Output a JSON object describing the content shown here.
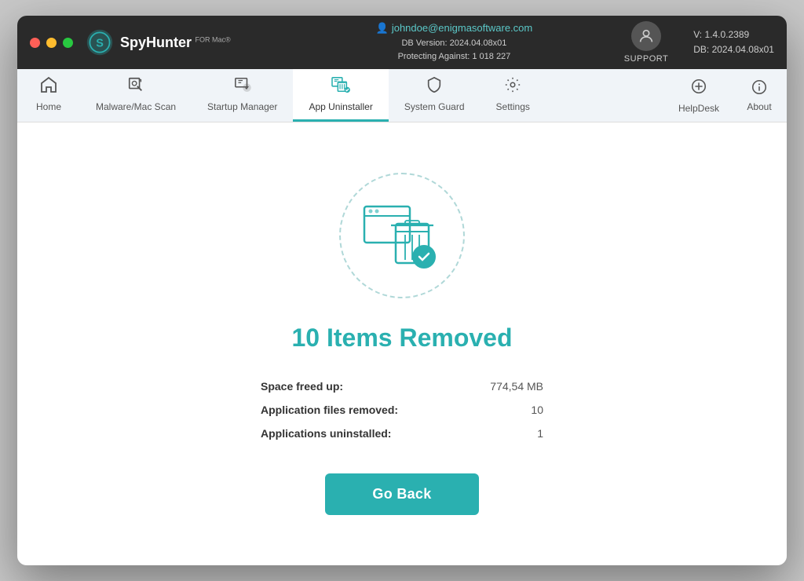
{
  "window": {
    "title": "SpyHunter for Mac"
  },
  "titlebar": {
    "brand": "SpyHunter",
    "brand_suffix": "FOR Mac®",
    "email": "johndoe@enigmasoftware.com",
    "db_version_label": "DB Version: 2024.04.08x01",
    "protecting_label": "Protecting Against: 1 018 227",
    "support_label": "SUPPORT",
    "version_label": "V: 1.4.0.2389",
    "db_label": "DB:  2024.04.08x01"
  },
  "nav": {
    "items": [
      {
        "id": "home",
        "label": "Home",
        "icon": "🏠"
      },
      {
        "id": "malware-scan",
        "label": "Malware/Mac Scan",
        "icon": "🔍"
      },
      {
        "id": "startup-manager",
        "label": "Startup Manager",
        "icon": "⚙"
      },
      {
        "id": "app-uninstaller",
        "label": "App Uninstaller",
        "icon": "📋",
        "active": true
      },
      {
        "id": "system-guard",
        "label": "System Guard",
        "icon": "🛡"
      },
      {
        "id": "settings",
        "label": "Settings",
        "icon": "⚙️"
      }
    ],
    "right_items": [
      {
        "id": "helpdesk",
        "label": "HelpDesk",
        "icon": "➕"
      },
      {
        "id": "about",
        "label": "About",
        "icon": "ℹ"
      }
    ]
  },
  "main": {
    "result_title": "10 Items Removed",
    "stats": [
      {
        "label": "Space freed up:",
        "value": "774,54 MB"
      },
      {
        "label": "Application files removed:",
        "value": "10"
      },
      {
        "label": "Applications uninstalled:",
        "value": "1"
      }
    ],
    "go_back_label": "Go Back"
  },
  "colors": {
    "teal": "#2ab0b0",
    "dark_bg": "#2a2a2a",
    "nav_bg": "#f0f4f8"
  }
}
